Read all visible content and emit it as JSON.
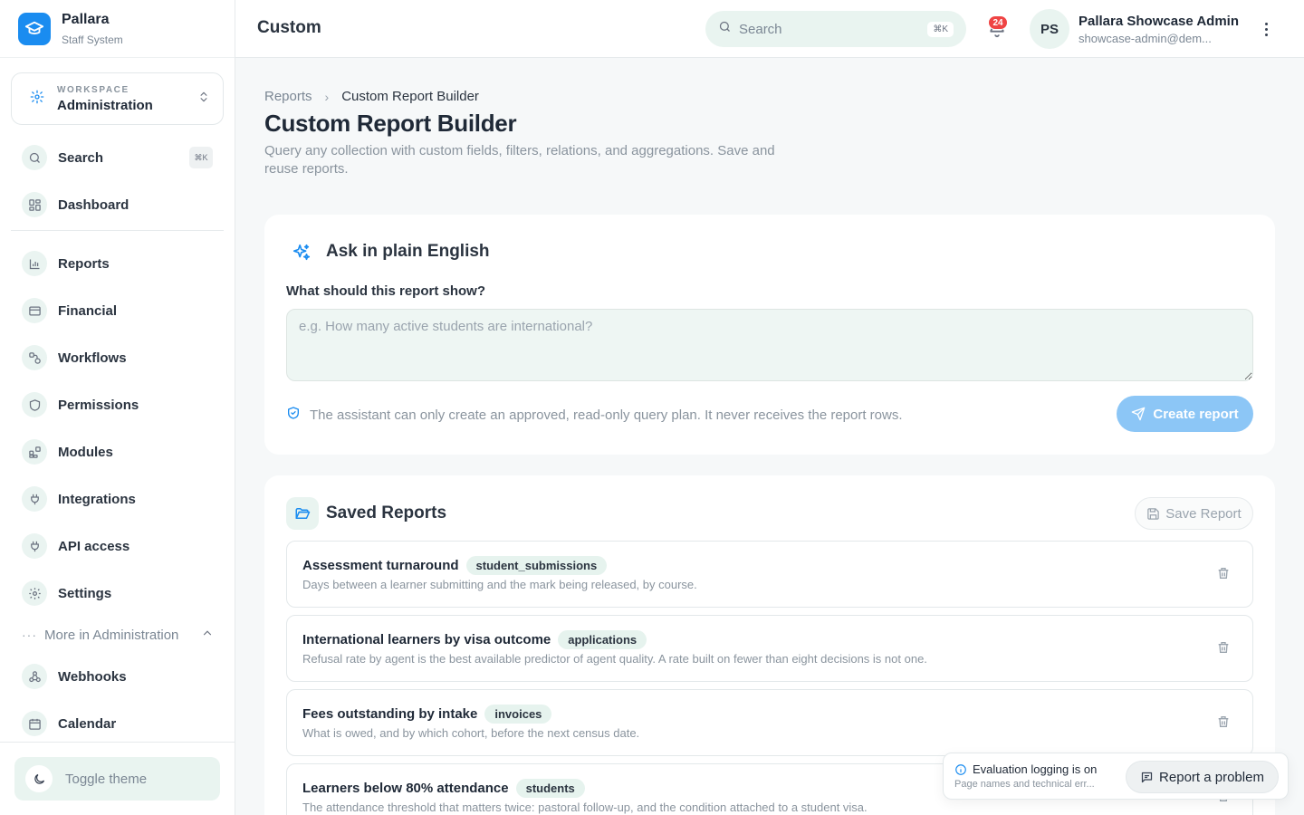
{
  "brand": {
    "name": "Pallara",
    "subtitle": "Staff System"
  },
  "workspace": {
    "label": "WORKSPACE",
    "value": "Administration"
  },
  "sidebar": {
    "search_label": "Search",
    "search_shortcut": "⌘K",
    "items": [
      {
        "label": "Dashboard",
        "icon": "dashboard-icon"
      },
      {
        "label": "Reports",
        "icon": "bar-chart-icon"
      },
      {
        "label": "Financial",
        "icon": "credit-card-icon"
      },
      {
        "label": "Workflows",
        "icon": "workflow-icon"
      },
      {
        "label": "Permissions",
        "icon": "shield-icon"
      },
      {
        "label": "Modules",
        "icon": "modules-icon"
      },
      {
        "label": "Integrations",
        "icon": "plug-icon"
      },
      {
        "label": "API access",
        "icon": "plug-icon"
      },
      {
        "label": "Settings",
        "icon": "gear-icon"
      },
      {
        "label": "Webhooks",
        "icon": "webhook-icon"
      },
      {
        "label": "Calendar",
        "icon": "calendar-icon"
      }
    ],
    "more_label": "More in Administration",
    "toggle_theme": "Toggle theme"
  },
  "topbar": {
    "title": "Custom",
    "search_placeholder": "Search",
    "search_shortcut": "⌘K",
    "notification_count": "24",
    "avatar_initials": "PS",
    "user_name": "Pallara Showcase Admin",
    "user_email": "showcase-admin@dem..."
  },
  "breadcrumb": {
    "parent": "Reports",
    "current": "Custom Report Builder"
  },
  "page": {
    "title": "Custom Report Builder",
    "description": "Query any collection with custom fields, filters, relations, and aggregations. Save and reuse reports."
  },
  "ask": {
    "title": "Ask in plain English",
    "question_label": "What should this report show?",
    "placeholder": "e.g. How many active students are international?",
    "value": "",
    "note": "The assistant can only create an approved, read-only query plan. It never receives the report rows.",
    "create_label": "Create report"
  },
  "saved": {
    "title": "Saved Reports",
    "save_label": "Save Report",
    "reports": [
      {
        "name": "Assessment turnaround",
        "collection": "student_submissions",
        "description": "Days between a learner submitting and the mark being released, by course."
      },
      {
        "name": "International learners by visa outcome",
        "collection": "applications",
        "description": "Refusal rate by agent is the best available predictor of agent quality. A rate built on fewer than eight decisions is not one."
      },
      {
        "name": "Fees outstanding by intake",
        "collection": "invoices",
        "description": "What is owed, and by which cohort, before the next census date."
      },
      {
        "name": "Learners below 80% attendance",
        "collection": "students",
        "description": "The attendance threshold that matters twice: pastoral follow-up, and the condition attached to a student visa."
      }
    ]
  },
  "toast": {
    "title": "Evaluation logging is on",
    "subtitle": "Page names and technical err...",
    "action_label": "Report a problem"
  },
  "colors": {
    "accent": "#1a8cf0",
    "mint": "#e9f4f0",
    "badge": "#ef4444",
    "button_disabled": "#8cc6f6"
  }
}
